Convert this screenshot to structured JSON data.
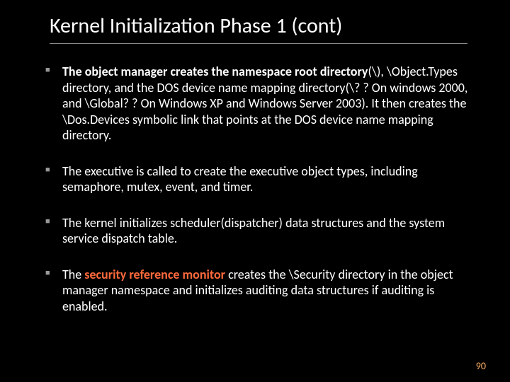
{
  "title": "Kernel Initialization Phase 1 (cont)",
  "bullets": [
    {
      "b1_bold": "The object manager creates the namespace root directory",
      "b1_rest": "(\\), \\Object.Types directory, and the DOS device name mapping directory(\\? ? On windows 2000, and \\Global? ? On Windows XP and Windows Server 2003). It then creates the \\Dos.Devices symbolic link that points at the DOS device name mapping directory."
    },
    {
      "b2": "The executive is called to create the executive object types, including semaphore, mutex, event, and timer."
    },
    {
      "b3": "The kernel initializes scheduler(dispatcher) data structures and the system service dispatch table."
    },
    {
      "b4_pre": "The ",
      "b4_red": "security reference monitor",
      "b4_post": " creates the \\Security directory in the object manager namespace and initializes auditing data structures if auditing is enabled."
    }
  ],
  "page_number": "90"
}
